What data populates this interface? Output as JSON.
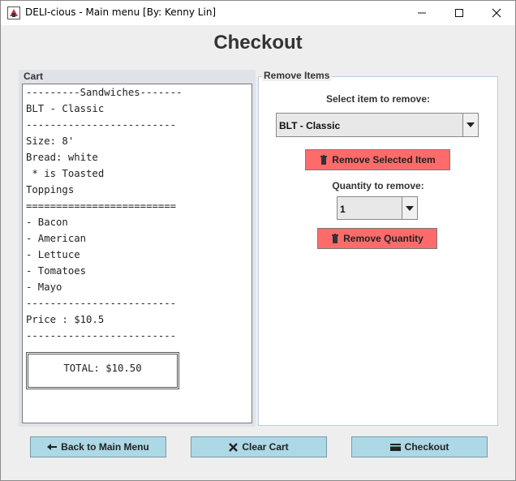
{
  "window": {
    "title": "DELI-cious - Main menu [By: Kenny Lin]"
  },
  "page": {
    "heading": "Checkout"
  },
  "cart": {
    "title": "Cart",
    "lines": [
      "---------Sandwiches-------",
      "BLT - Classic",
      "-------------------------",
      "Size: 8'",
      "Bread: white",
      " * is Toasted",
      "Toppings",
      "=========================",
      "- Bacon",
      "- American",
      "- Lettuce",
      "- Tomatoes",
      "- Mayo",
      "-------------------------",
      "Price : $10.5",
      "-------------------------"
    ],
    "total": "TOTAL: $10.50"
  },
  "remove": {
    "title": "Remove Items",
    "select_label": "Select item to remove:",
    "selected_item": "BLT - Classic",
    "remove_selected_label": "Remove Selected Item",
    "quantity_label": "Quantity to remove:",
    "quantity_value": "1",
    "remove_quantity_label": "Remove Quantity"
  },
  "actions": {
    "back_label": "Back to Main Menu",
    "clear_label": "Clear Cart",
    "checkout_label": "Checkout"
  },
  "colors": {
    "red_button": "#ff6b6b",
    "blue_button": "#add8e6",
    "panel_border": "#b8cfe5"
  },
  "icons": [
    "app-icon",
    "minimize-icon",
    "maximize-icon",
    "close-icon",
    "chevron-down-icon",
    "trash-icon",
    "arrow-left-icon",
    "x-icon",
    "card-icon"
  ]
}
